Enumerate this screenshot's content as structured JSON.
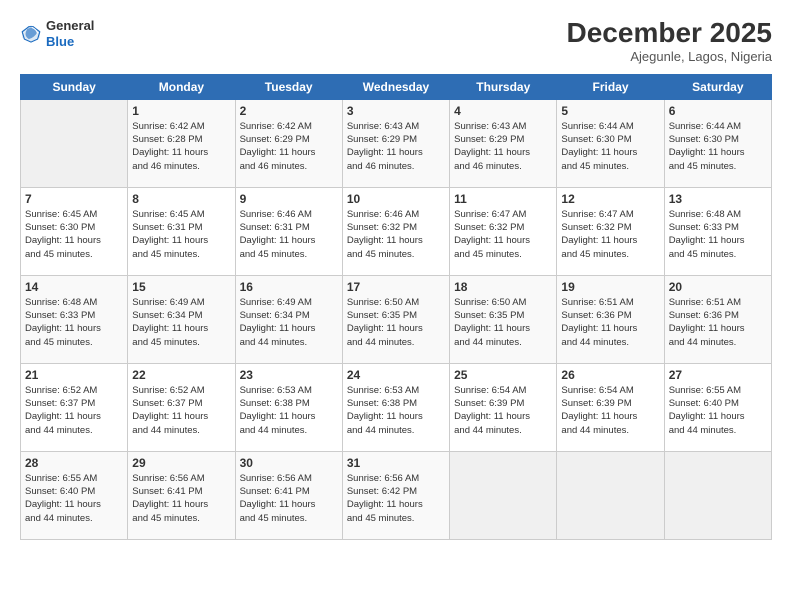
{
  "header": {
    "logo_line1": "General",
    "logo_line2": "Blue",
    "month": "December 2025",
    "location": "Ajegunle, Lagos, Nigeria"
  },
  "days_of_week": [
    "Sunday",
    "Monday",
    "Tuesday",
    "Wednesday",
    "Thursday",
    "Friday",
    "Saturday"
  ],
  "weeks": [
    [
      {
        "day": "",
        "info": ""
      },
      {
        "day": "1",
        "info": "Sunrise: 6:42 AM\nSunset: 6:28 PM\nDaylight: 11 hours\nand 46 minutes."
      },
      {
        "day": "2",
        "info": "Sunrise: 6:42 AM\nSunset: 6:29 PM\nDaylight: 11 hours\nand 46 minutes."
      },
      {
        "day": "3",
        "info": "Sunrise: 6:43 AM\nSunset: 6:29 PM\nDaylight: 11 hours\nand 46 minutes."
      },
      {
        "day": "4",
        "info": "Sunrise: 6:43 AM\nSunset: 6:29 PM\nDaylight: 11 hours\nand 46 minutes."
      },
      {
        "day": "5",
        "info": "Sunrise: 6:44 AM\nSunset: 6:30 PM\nDaylight: 11 hours\nand 45 minutes."
      },
      {
        "day": "6",
        "info": "Sunrise: 6:44 AM\nSunset: 6:30 PM\nDaylight: 11 hours\nand 45 minutes."
      }
    ],
    [
      {
        "day": "7",
        "info": "Sunrise: 6:45 AM\nSunset: 6:30 PM\nDaylight: 11 hours\nand 45 minutes."
      },
      {
        "day": "8",
        "info": "Sunrise: 6:45 AM\nSunset: 6:31 PM\nDaylight: 11 hours\nand 45 minutes."
      },
      {
        "day": "9",
        "info": "Sunrise: 6:46 AM\nSunset: 6:31 PM\nDaylight: 11 hours\nand 45 minutes."
      },
      {
        "day": "10",
        "info": "Sunrise: 6:46 AM\nSunset: 6:32 PM\nDaylight: 11 hours\nand 45 minutes."
      },
      {
        "day": "11",
        "info": "Sunrise: 6:47 AM\nSunset: 6:32 PM\nDaylight: 11 hours\nand 45 minutes."
      },
      {
        "day": "12",
        "info": "Sunrise: 6:47 AM\nSunset: 6:32 PM\nDaylight: 11 hours\nand 45 minutes."
      },
      {
        "day": "13",
        "info": "Sunrise: 6:48 AM\nSunset: 6:33 PM\nDaylight: 11 hours\nand 45 minutes."
      }
    ],
    [
      {
        "day": "14",
        "info": "Sunrise: 6:48 AM\nSunset: 6:33 PM\nDaylight: 11 hours\nand 45 minutes."
      },
      {
        "day": "15",
        "info": "Sunrise: 6:49 AM\nSunset: 6:34 PM\nDaylight: 11 hours\nand 45 minutes."
      },
      {
        "day": "16",
        "info": "Sunrise: 6:49 AM\nSunset: 6:34 PM\nDaylight: 11 hours\nand 44 minutes."
      },
      {
        "day": "17",
        "info": "Sunrise: 6:50 AM\nSunset: 6:35 PM\nDaylight: 11 hours\nand 44 minutes."
      },
      {
        "day": "18",
        "info": "Sunrise: 6:50 AM\nSunset: 6:35 PM\nDaylight: 11 hours\nand 44 minutes."
      },
      {
        "day": "19",
        "info": "Sunrise: 6:51 AM\nSunset: 6:36 PM\nDaylight: 11 hours\nand 44 minutes."
      },
      {
        "day": "20",
        "info": "Sunrise: 6:51 AM\nSunset: 6:36 PM\nDaylight: 11 hours\nand 44 minutes."
      }
    ],
    [
      {
        "day": "21",
        "info": "Sunrise: 6:52 AM\nSunset: 6:37 PM\nDaylight: 11 hours\nand 44 minutes."
      },
      {
        "day": "22",
        "info": "Sunrise: 6:52 AM\nSunset: 6:37 PM\nDaylight: 11 hours\nand 44 minutes."
      },
      {
        "day": "23",
        "info": "Sunrise: 6:53 AM\nSunset: 6:38 PM\nDaylight: 11 hours\nand 44 minutes."
      },
      {
        "day": "24",
        "info": "Sunrise: 6:53 AM\nSunset: 6:38 PM\nDaylight: 11 hours\nand 44 minutes."
      },
      {
        "day": "25",
        "info": "Sunrise: 6:54 AM\nSunset: 6:39 PM\nDaylight: 11 hours\nand 44 minutes."
      },
      {
        "day": "26",
        "info": "Sunrise: 6:54 AM\nSunset: 6:39 PM\nDaylight: 11 hours\nand 44 minutes."
      },
      {
        "day": "27",
        "info": "Sunrise: 6:55 AM\nSunset: 6:40 PM\nDaylight: 11 hours\nand 44 minutes."
      }
    ],
    [
      {
        "day": "28",
        "info": "Sunrise: 6:55 AM\nSunset: 6:40 PM\nDaylight: 11 hours\nand 44 minutes."
      },
      {
        "day": "29",
        "info": "Sunrise: 6:56 AM\nSunset: 6:41 PM\nDaylight: 11 hours\nand 45 minutes."
      },
      {
        "day": "30",
        "info": "Sunrise: 6:56 AM\nSunset: 6:41 PM\nDaylight: 11 hours\nand 45 minutes."
      },
      {
        "day": "31",
        "info": "Sunrise: 6:56 AM\nSunset: 6:42 PM\nDaylight: 11 hours\nand 45 minutes."
      },
      {
        "day": "",
        "info": ""
      },
      {
        "day": "",
        "info": ""
      },
      {
        "day": "",
        "info": ""
      }
    ]
  ]
}
